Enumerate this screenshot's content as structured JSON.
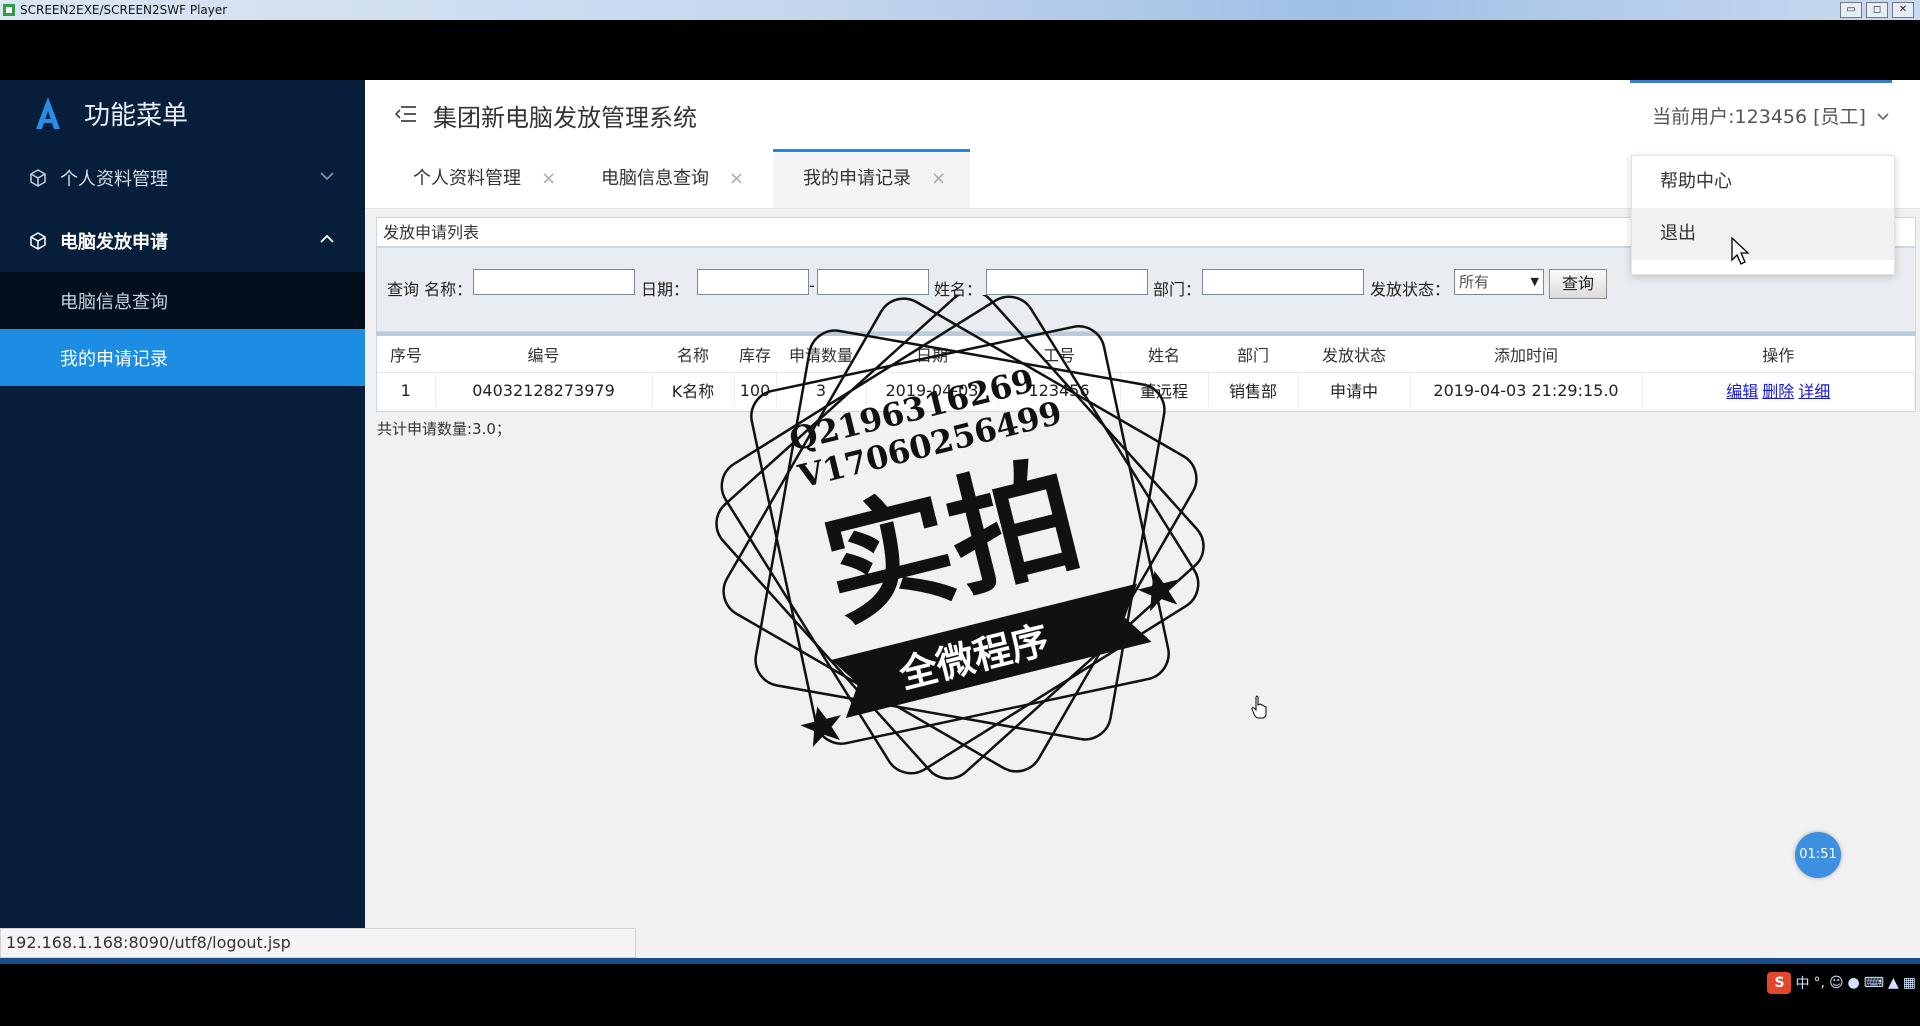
{
  "player": {
    "title": "SCREEN2EXE/SCREEN2SWF Player",
    "min_label": "▭",
    "max_label": "◻",
    "close_label": "✕"
  },
  "sidebar": {
    "title": "功能菜单",
    "groups": [
      {
        "label": "个人资料管理",
        "expanded": false
      },
      {
        "label": "电脑发放申请",
        "expanded": true,
        "items": [
          {
            "label": "电脑信息查询",
            "active": false
          },
          {
            "label": "我的申请记录",
            "active": true
          }
        ]
      }
    ]
  },
  "header": {
    "system_title": "集团新电脑发放管理系统",
    "user_info": "当前用户:123456 [员工]"
  },
  "tabs": [
    {
      "label": "个人资料管理",
      "close": "×"
    },
    {
      "label": "电脑信息查询",
      "close": "×"
    },
    {
      "label": "我的申请记录",
      "close": "×",
      "active": true
    }
  ],
  "panel": {
    "title": "发放申请列表",
    "search": {
      "prefix": "查询 名称：",
      "date_label": "日期：",
      "date_sep": "-",
      "name_label": "姓名：",
      "dept_label": "部门：",
      "status_label": "发放状态：",
      "status_value": "所有",
      "query_button": "查询"
    },
    "columns": [
      "序号",
      "编号",
      "名称",
      "库存",
      "申请数量",
      "日期",
      "工号",
      "姓名",
      "部门",
      "发放状态",
      "添加时间",
      "操作"
    ],
    "rows": [
      {
        "seq": "1",
        "code": "04032128273979",
        "name": "K名称",
        "stock": "100",
        "qty": "3",
        "date": "2019-04-03",
        "emp_no": "123456",
        "person": "董远程",
        "dept": "销售部",
        "status": "申请中",
        "added": "2019-04-03 21:29:15.0",
        "actions": [
          "编辑",
          "删除",
          "详细"
        ]
      }
    ],
    "summary": "共计申请数量:3.0；"
  },
  "dropdown": {
    "items": [
      "帮助中心",
      "退出"
    ]
  },
  "watermark": {
    "line1": "Q2196316269",
    "line2": "V17060256499",
    "big": "实拍",
    "ribbon": "全微程序"
  },
  "timer": "01:51",
  "status_url": "192.168.1.168:8090/utf8/logout.jsp",
  "ime": {
    "logo": "S",
    "mode": "中",
    "punct": "°,"
  },
  "colors": {
    "sidebar": "#071f3a",
    "active": "#1c8de2",
    "accent": "#1e88e5"
  }
}
